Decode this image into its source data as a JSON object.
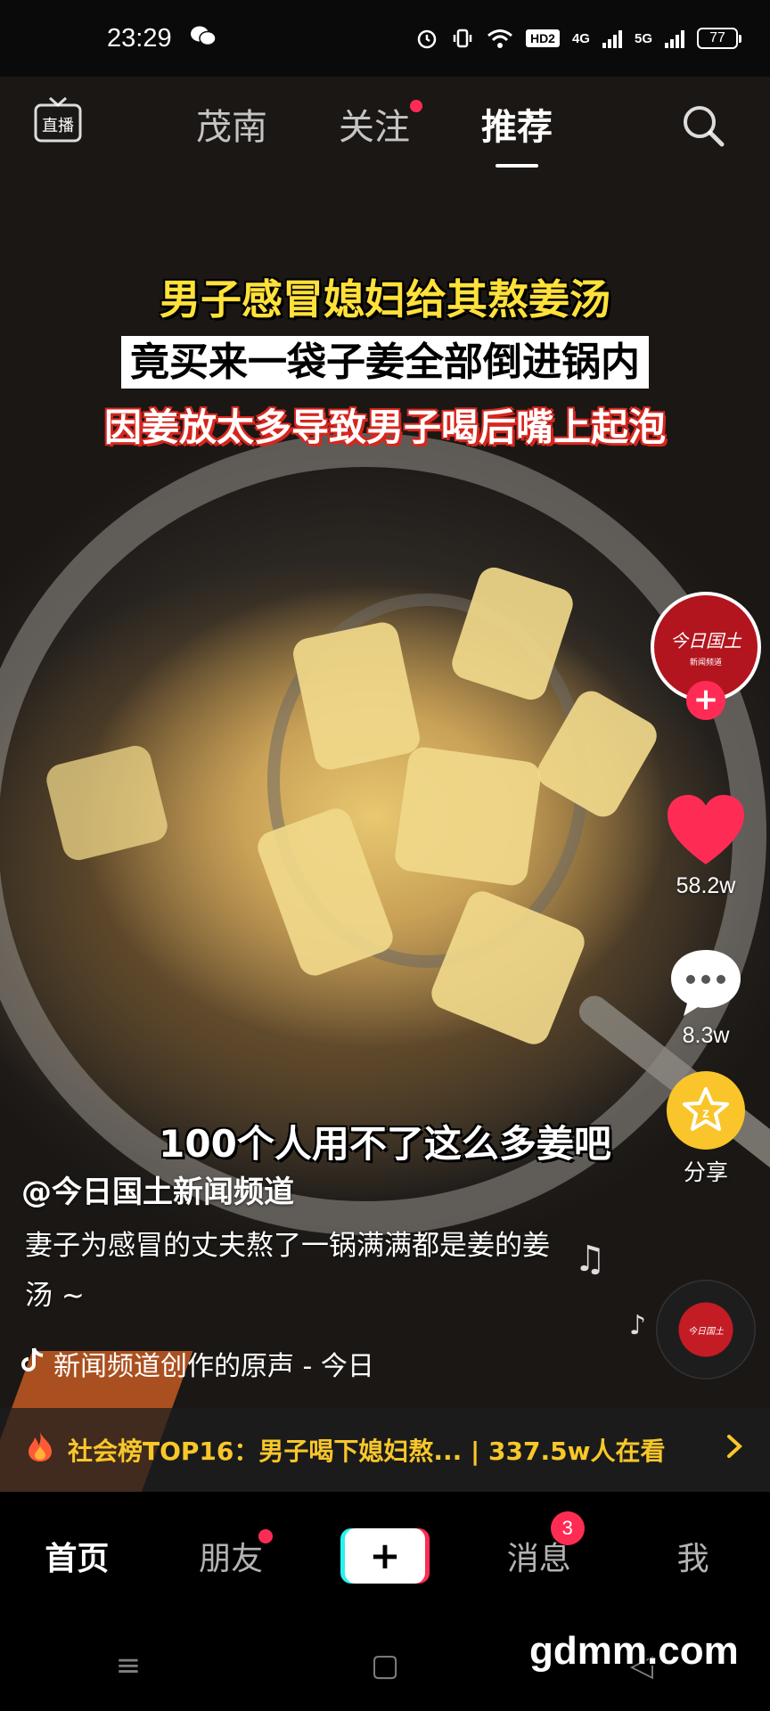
{
  "status_bar": {
    "time": "23:29",
    "network_hd": "HD2",
    "net1": "4G",
    "net2": "5G",
    "battery": "77"
  },
  "top_nav": {
    "live_label": "直播",
    "tabs": [
      {
        "label": "茂南"
      },
      {
        "label": "关注"
      },
      {
        "label": "推荐"
      }
    ]
  },
  "video": {
    "caption_line1": "男子感冒媳妇给其熬姜汤",
    "caption_line2": "竟买来一袋子姜全部倒进锅内",
    "caption_line3": "因姜放太多导致男子喝后嘴上起泡",
    "caption_bottom": "100个人用不了这么多姜吧"
  },
  "actions": {
    "avatar_text": "今日国土",
    "avatar_sub": "新闻频道",
    "likes": "58.2w",
    "comments": "8.3w",
    "share_label": "分享"
  },
  "post": {
    "author": "@今日国土新闻频道",
    "description": "妻子为感冒的丈夫熬了一锅满满都是姜的姜汤 ~",
    "music": "新闻频道创作的原声 - 今日"
  },
  "hot_bar": {
    "text": "社会榜TOP16：男子喝下媳妇熬... | 337.5w人在看"
  },
  "bottom_nav": {
    "home": "首页",
    "friends": "朋友",
    "messages": "消息",
    "messages_badge": "3",
    "me": "我"
  },
  "watermark": "gdmm.com",
  "colors": {
    "accent": "#fe2c55",
    "caption_yellow": "#ffe13a",
    "hot_text": "#f8c72a"
  }
}
